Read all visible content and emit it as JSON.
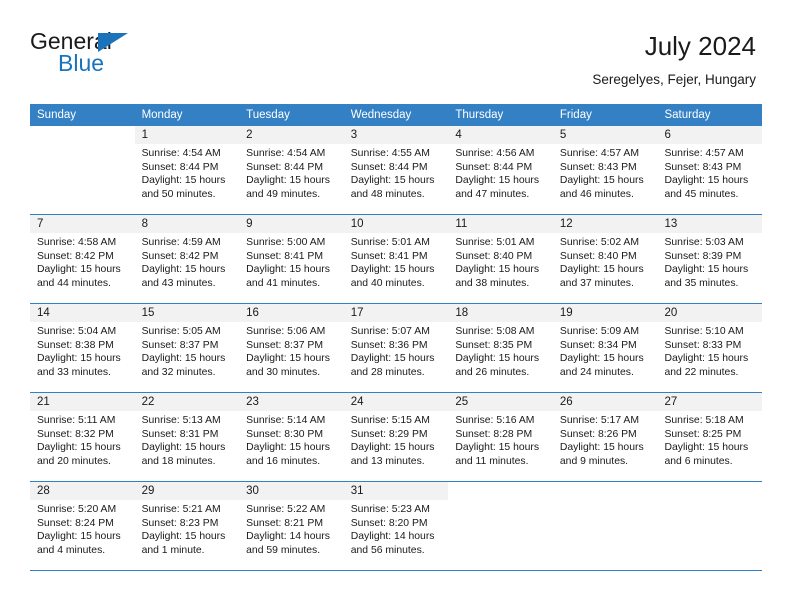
{
  "brand": {
    "word_one": "General",
    "word_two": "Blue",
    "triangle_color": "#1b74bb",
    "blue_color": "#1b74bb",
    "dark_color": "#1a1a1a"
  },
  "header": {
    "title": "July 2024",
    "subtitle": "Seregelyes, Fejer, Hungary"
  },
  "theme": {
    "header_bg": "#3480c4",
    "header_text": "#ffffff",
    "date_band_bg": "#f2f2f2",
    "row_divider": "#3480c4"
  },
  "weekdays": [
    "Sunday",
    "Monday",
    "Tuesday",
    "Wednesday",
    "Thursday",
    "Friday",
    "Saturday"
  ],
  "weeks": [
    [
      {
        "empty": true
      },
      {
        "day": "1",
        "sunrise": "Sunrise: 4:54 AM",
        "sunset": "Sunset: 8:44 PM",
        "daylight1": "Daylight: 15 hours",
        "daylight2": "and 50 minutes."
      },
      {
        "day": "2",
        "sunrise": "Sunrise: 4:54 AM",
        "sunset": "Sunset: 8:44 PM",
        "daylight1": "Daylight: 15 hours",
        "daylight2": "and 49 minutes."
      },
      {
        "day": "3",
        "sunrise": "Sunrise: 4:55 AM",
        "sunset": "Sunset: 8:44 PM",
        "daylight1": "Daylight: 15 hours",
        "daylight2": "and 48 minutes."
      },
      {
        "day": "4",
        "sunrise": "Sunrise: 4:56 AM",
        "sunset": "Sunset: 8:44 PM",
        "daylight1": "Daylight: 15 hours",
        "daylight2": "and 47 minutes."
      },
      {
        "day": "5",
        "sunrise": "Sunrise: 4:57 AM",
        "sunset": "Sunset: 8:43 PM",
        "daylight1": "Daylight: 15 hours",
        "daylight2": "and 46 minutes."
      },
      {
        "day": "6",
        "sunrise": "Sunrise: 4:57 AM",
        "sunset": "Sunset: 8:43 PM",
        "daylight1": "Daylight: 15 hours",
        "daylight2": "and 45 minutes."
      }
    ],
    [
      {
        "day": "7",
        "sunrise": "Sunrise: 4:58 AM",
        "sunset": "Sunset: 8:42 PM",
        "daylight1": "Daylight: 15 hours",
        "daylight2": "and 44 minutes."
      },
      {
        "day": "8",
        "sunrise": "Sunrise: 4:59 AM",
        "sunset": "Sunset: 8:42 PM",
        "daylight1": "Daylight: 15 hours",
        "daylight2": "and 43 minutes."
      },
      {
        "day": "9",
        "sunrise": "Sunrise: 5:00 AM",
        "sunset": "Sunset: 8:41 PM",
        "daylight1": "Daylight: 15 hours",
        "daylight2": "and 41 minutes."
      },
      {
        "day": "10",
        "sunrise": "Sunrise: 5:01 AM",
        "sunset": "Sunset: 8:41 PM",
        "daylight1": "Daylight: 15 hours",
        "daylight2": "and 40 minutes."
      },
      {
        "day": "11",
        "sunrise": "Sunrise: 5:01 AM",
        "sunset": "Sunset: 8:40 PM",
        "daylight1": "Daylight: 15 hours",
        "daylight2": "and 38 minutes."
      },
      {
        "day": "12",
        "sunrise": "Sunrise: 5:02 AM",
        "sunset": "Sunset: 8:40 PM",
        "daylight1": "Daylight: 15 hours",
        "daylight2": "and 37 minutes."
      },
      {
        "day": "13",
        "sunrise": "Sunrise: 5:03 AM",
        "sunset": "Sunset: 8:39 PM",
        "daylight1": "Daylight: 15 hours",
        "daylight2": "and 35 minutes."
      }
    ],
    [
      {
        "day": "14",
        "sunrise": "Sunrise: 5:04 AM",
        "sunset": "Sunset: 8:38 PM",
        "daylight1": "Daylight: 15 hours",
        "daylight2": "and 33 minutes."
      },
      {
        "day": "15",
        "sunrise": "Sunrise: 5:05 AM",
        "sunset": "Sunset: 8:37 PM",
        "daylight1": "Daylight: 15 hours",
        "daylight2": "and 32 minutes."
      },
      {
        "day": "16",
        "sunrise": "Sunrise: 5:06 AM",
        "sunset": "Sunset: 8:37 PM",
        "daylight1": "Daylight: 15 hours",
        "daylight2": "and 30 minutes."
      },
      {
        "day": "17",
        "sunrise": "Sunrise: 5:07 AM",
        "sunset": "Sunset: 8:36 PM",
        "daylight1": "Daylight: 15 hours",
        "daylight2": "and 28 minutes."
      },
      {
        "day": "18",
        "sunrise": "Sunrise: 5:08 AM",
        "sunset": "Sunset: 8:35 PM",
        "daylight1": "Daylight: 15 hours",
        "daylight2": "and 26 minutes."
      },
      {
        "day": "19",
        "sunrise": "Sunrise: 5:09 AM",
        "sunset": "Sunset: 8:34 PM",
        "daylight1": "Daylight: 15 hours",
        "daylight2": "and 24 minutes."
      },
      {
        "day": "20",
        "sunrise": "Sunrise: 5:10 AM",
        "sunset": "Sunset: 8:33 PM",
        "daylight1": "Daylight: 15 hours",
        "daylight2": "and 22 minutes."
      }
    ],
    [
      {
        "day": "21",
        "sunrise": "Sunrise: 5:11 AM",
        "sunset": "Sunset: 8:32 PM",
        "daylight1": "Daylight: 15 hours",
        "daylight2": "and 20 minutes."
      },
      {
        "day": "22",
        "sunrise": "Sunrise: 5:13 AM",
        "sunset": "Sunset: 8:31 PM",
        "daylight1": "Daylight: 15 hours",
        "daylight2": "and 18 minutes."
      },
      {
        "day": "23",
        "sunrise": "Sunrise: 5:14 AM",
        "sunset": "Sunset: 8:30 PM",
        "daylight1": "Daylight: 15 hours",
        "daylight2": "and 16 minutes."
      },
      {
        "day": "24",
        "sunrise": "Sunrise: 5:15 AM",
        "sunset": "Sunset: 8:29 PM",
        "daylight1": "Daylight: 15 hours",
        "daylight2": "and 13 minutes."
      },
      {
        "day": "25",
        "sunrise": "Sunrise: 5:16 AM",
        "sunset": "Sunset: 8:28 PM",
        "daylight1": "Daylight: 15 hours",
        "daylight2": "and 11 minutes."
      },
      {
        "day": "26",
        "sunrise": "Sunrise: 5:17 AM",
        "sunset": "Sunset: 8:26 PM",
        "daylight1": "Daylight: 15 hours",
        "daylight2": "and 9 minutes."
      },
      {
        "day": "27",
        "sunrise": "Sunrise: 5:18 AM",
        "sunset": "Sunset: 8:25 PM",
        "daylight1": "Daylight: 15 hours",
        "daylight2": "and 6 minutes."
      }
    ],
    [
      {
        "day": "28",
        "sunrise": "Sunrise: 5:20 AM",
        "sunset": "Sunset: 8:24 PM",
        "daylight1": "Daylight: 15 hours",
        "daylight2": "and 4 minutes."
      },
      {
        "day": "29",
        "sunrise": "Sunrise: 5:21 AM",
        "sunset": "Sunset: 8:23 PM",
        "daylight1": "Daylight: 15 hours",
        "daylight2": "and 1 minute."
      },
      {
        "day": "30",
        "sunrise": "Sunrise: 5:22 AM",
        "sunset": "Sunset: 8:21 PM",
        "daylight1": "Daylight: 14 hours",
        "daylight2": "and 59 minutes."
      },
      {
        "day": "31",
        "sunrise": "Sunrise: 5:23 AM",
        "sunset": "Sunset: 8:20 PM",
        "daylight1": "Daylight: 14 hours",
        "daylight2": "and 56 minutes."
      },
      {
        "empty": true
      },
      {
        "empty": true
      },
      {
        "empty": true
      }
    ]
  ]
}
